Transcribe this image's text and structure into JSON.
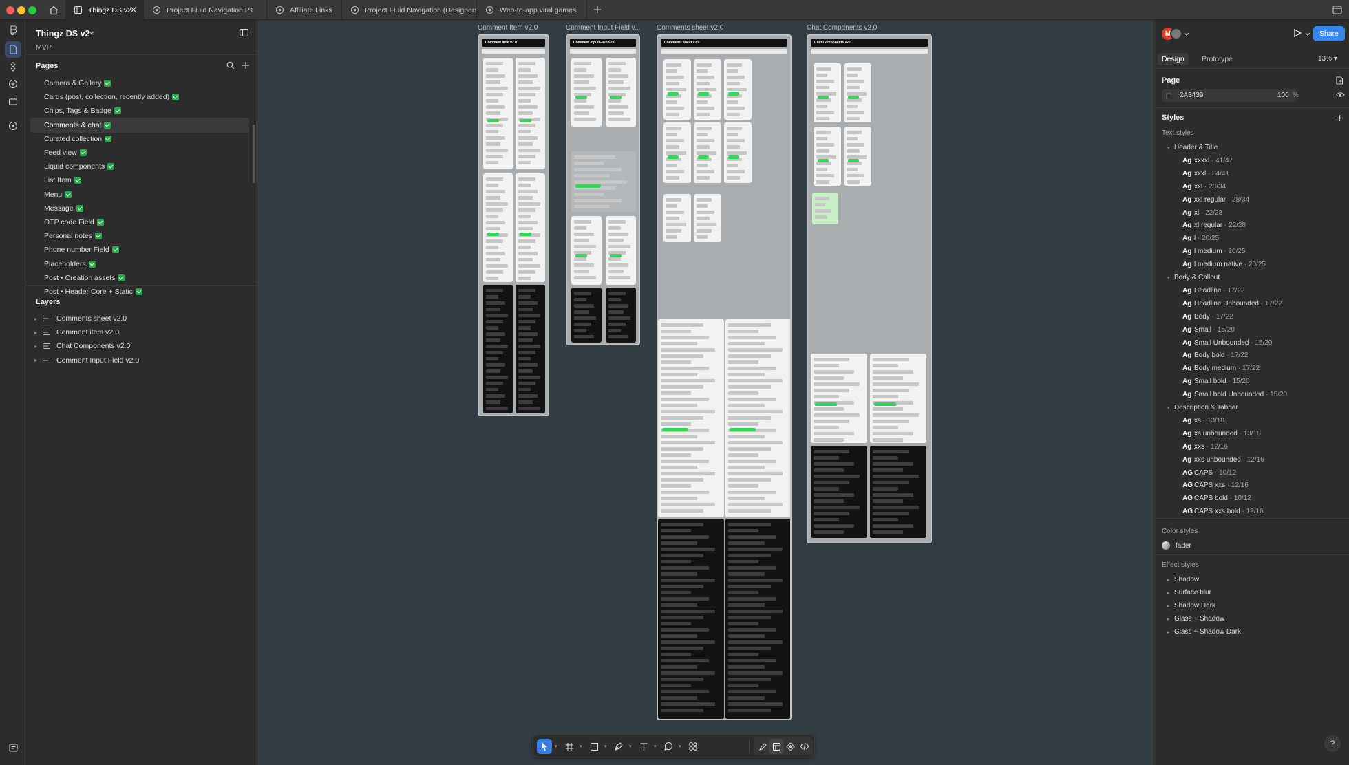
{
  "tabs": [
    {
      "label": "Thingz DS v2"
    },
    {
      "label": "Project Fluid Navigation P1"
    },
    {
      "label": "Affiliate Links"
    },
    {
      "label": "Project Fluid Navigation (Designers C"
    },
    {
      "label": "Web-to-app viral games"
    }
  ],
  "left": {
    "project_name": "Thingz DS v2",
    "project_sub": "MVP",
    "pages_title": "Pages",
    "pages": [
      "Camera & Gallery",
      "Cards (post, collection, recently added)",
      "Chips, Tags & Badge",
      "Comments & chat",
      "Curated collection",
      "Feed view",
      "Liquid components",
      "List Item",
      "Menu",
      "Message",
      "OTP code Field",
      "Personal notes",
      "Phone number Field",
      "Placeholders",
      "Post • Creation assets",
      "Post • Header Core + Static"
    ],
    "layers_title": "Layers",
    "layers": [
      "Comments sheet v2.0",
      "Comment item v2.0",
      "Chat Components v2.0",
      "Comment Input Field v2.0"
    ]
  },
  "canvas": {
    "frames": [
      {
        "label": "Comment Item v2.0",
        "header": "Comment Item v2.0"
      },
      {
        "label": "Comment Input Field v...",
        "header": "Comment Input Field v2.0"
      },
      {
        "label": "Comments sheet v2.0",
        "header": "Comments sheet v2.0"
      },
      {
        "label": "Chat Components v2.0",
        "header": "Chat Components v2.0"
      }
    ]
  },
  "right": {
    "avatar_letter": "M",
    "share": "Share",
    "design_tab": "Design",
    "prototype_tab": "Prototype",
    "zoom": "13%",
    "page_title": "Page",
    "page_color": "2A3439",
    "page_opacity": "100",
    "pct": "%",
    "styles_title": "Styles",
    "text_styles": "Text styles",
    "groups": [
      {
        "name": "Header & Title",
        "items": [
          [
            "Ag",
            "xxxxl",
            "41/47"
          ],
          [
            "Ag",
            "xxxl",
            "34/41"
          ],
          [
            "Ag",
            "xxl",
            "28/34"
          ],
          [
            "Ag",
            "xxl regular",
            "28/34"
          ],
          [
            "Ag",
            "xl",
            "22/28"
          ],
          [
            "Ag",
            "xl regular",
            "22/28"
          ],
          [
            "Ag",
            "l",
            "20/25"
          ],
          [
            "Ag",
            "l medium",
            "20/25"
          ],
          [
            "Ag",
            "l medium native",
            "20/25"
          ]
        ]
      },
      {
        "name": "Body & Callout",
        "items": [
          [
            "Ag",
            "Headline",
            "17/22"
          ],
          [
            "Ag",
            "Headline Unbounded",
            "17/22"
          ],
          [
            "Ag",
            "Body",
            "17/22"
          ],
          [
            "Ag",
            "Small",
            "15/20"
          ],
          [
            "Ag",
            "Small Unbounded",
            "15/20"
          ],
          [
            "Ag",
            "Body bold",
            "17/22"
          ],
          [
            "Ag",
            "Body medium",
            "17/22"
          ],
          [
            "Ag",
            "Small bold",
            "15/20"
          ],
          [
            "Ag",
            "Small bold Unbounded",
            "15/20"
          ]
        ]
      },
      {
        "name": "Description & Tabbar",
        "items": [
          [
            "Ag",
            "xs",
            "13/18"
          ],
          [
            "Ag",
            "xs unbounded",
            "13/18"
          ],
          [
            "Ag",
            "xxs",
            "12/16"
          ],
          [
            "Ag",
            "xxs unbounded",
            "12/16"
          ],
          [
            "AG",
            "CAPS",
            "10/12"
          ],
          [
            "AG",
            "CAPS xxs",
            "12/16"
          ],
          [
            "AG",
            "CAPS bold",
            "10/12"
          ],
          [
            "AG",
            "CAPS xxs bold",
            "12/16"
          ]
        ]
      }
    ],
    "color_styles": "Color styles",
    "color_items": [
      "fader"
    ],
    "effect_styles": "Effect styles",
    "effect_items": [
      "Shadow",
      "Surface blur",
      "Shadow Dark",
      "Glass + Shadow",
      "Glass + Shadow Dark"
    ],
    "help": "?"
  },
  "colors": {
    "accent": "#3a85e8",
    "canvas": "#2A3439",
    "check": "#2fa44f"
  }
}
